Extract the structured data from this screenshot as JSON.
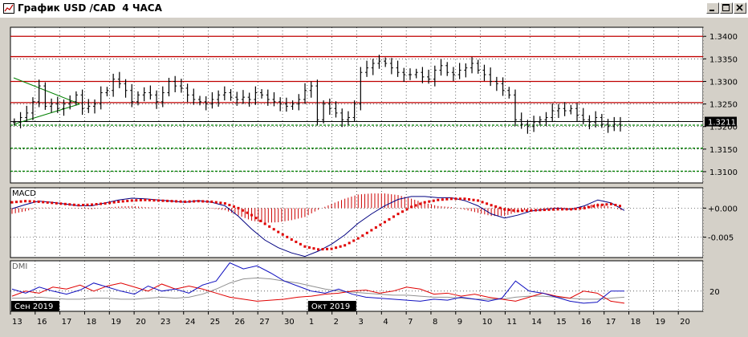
{
  "window": {
    "title": "График USD /CAD  4 ЧАСА",
    "buttons": [
      "minimize",
      "maximize",
      "close"
    ]
  },
  "colors": {
    "price_bars": "#000000",
    "resistance_lines": "#c00000",
    "support_lines": "#008000",
    "current_price_box": "#000000",
    "macd_line": "#000080",
    "macd_signal": "#e00000",
    "macd_histogram": "#cc0000",
    "dmi_plus": "#1010c0",
    "dmi_minus": "#e00000",
    "adx": "#909090"
  },
  "chart_data": {
    "type": "ohlc",
    "title": "",
    "panels": {
      "price": {
        "ylim": [
          1.3075,
          1.342
        ],
        "tick_labels": [
          "1.3400",
          "1.3350",
          "1.3300",
          "1.3250",
          "1.3200",
          "1.3150",
          "1.3100"
        ],
        "current_price": "1.3211",
        "horizontal_levels": {
          "red": [
            1.34,
            1.3355,
            1.33,
            1.3253
          ],
          "green": [
            1.3203,
            1.3152,
            1.3101
          ],
          "black": [
            1.3211
          ]
        },
        "triangle_lines": [
          {
            "color": "green",
            "from": [
              "13",
              1.3205
            ],
            "to": [
              "17",
              1.325
            ]
          },
          {
            "color": "green",
            "from": [
              "13",
              1.3308
            ],
            "to": [
              "17",
              1.325
            ]
          }
        ],
        "series": [
          {
            "day": "13",
            "close": [
              1.321,
              1.322,
              1.323,
              1.3255
            ]
          },
          {
            "day": "16",
            "close": [
              1.329,
              1.3245,
              1.325,
              1.324
            ]
          },
          {
            "day": "17",
            "close": [
              1.325,
              1.3255,
              1.327,
              1.324
            ]
          },
          {
            "day": "18",
            "close": [
              1.3245,
              1.325,
              1.3275,
              1.328
            ]
          },
          {
            "day": "19",
            "close": [
              1.3305,
              1.3295,
              1.328,
              1.3255
            ]
          },
          {
            "day": "20",
            "close": [
              1.327,
              1.3275,
              1.327,
              1.3255
            ]
          },
          {
            "day": "23",
            "close": [
              1.3275,
              1.33,
              1.329,
              1.3285
            ]
          },
          {
            "day": "24",
            "close": [
              1.327,
              1.326,
              1.3255,
              1.325
            ]
          },
          {
            "day": "25",
            "close": [
              1.326,
              1.327,
              1.3275,
              1.3265
            ]
          },
          {
            "day": "26",
            "close": [
              1.326,
              1.3265,
              1.326,
              1.3275
            ]
          },
          {
            "day": "27",
            "close": [
              1.327,
              1.326,
              1.3255,
              1.325
            ]
          },
          {
            "day": "30",
            "close": [
              1.3245,
              1.325,
              1.326,
              1.328
            ]
          },
          {
            "day": "1",
            "close": [
              1.329,
              1.3215,
              1.325,
              1.324
            ]
          },
          {
            "day": "2",
            "close": [
              1.323,
              1.3215,
              1.322,
              1.325
            ]
          },
          {
            "day": "3",
            "close": [
              1.332,
              1.333,
              1.334,
              1.3345
            ]
          },
          {
            "day": "4",
            "close": [
              1.334,
              1.333,
              1.332,
              1.3315
            ]
          },
          {
            "day": "7",
            "close": [
              1.3315,
              1.332,
              1.331,
              1.3305
            ]
          },
          {
            "day": "8",
            "close": [
              1.3325,
              1.3335,
              1.332,
              1.3315
            ]
          },
          {
            "day": "9",
            "close": [
              1.3325,
              1.333,
              1.334,
              1.3325
            ]
          },
          {
            "day": "10",
            "close": [
              1.3315,
              1.33,
              1.3295,
              1.328
            ]
          },
          {
            "day": "11",
            "close": [
              1.327,
              1.3215,
              1.3205,
              1.32
            ]
          },
          {
            "day": "14",
            "close": [
              1.321,
              1.3215,
              1.322,
              1.3235
            ]
          },
          {
            "day": "15",
            "close": [
              1.324,
              1.3235,
              1.324,
              1.3225
            ]
          },
          {
            "day": "16",
            "close": [
              1.3215,
              1.321,
              1.322,
              1.3205
            ]
          },
          {
            "day": "17",
            "close": [
              1.32,
              1.3205,
              1.3211
            ]
          }
        ]
      },
      "macd": {
        "label": "MACD",
        "tick_labels": [
          "+0.000",
          "-0.005"
        ],
        "ylim": [
          -0.0085,
          0.0035
        ],
        "macd_line": [
          -0.0001,
          0.0006,
          0.0012,
          0.001,
          0.0007,
          0.0004,
          0.0004,
          0.0009,
          0.0014,
          0.0017,
          0.0016,
          0.0014,
          0.0012,
          0.001,
          0.0013,
          0.001,
          0.0004,
          -0.0014,
          -0.0036,
          -0.0055,
          -0.0068,
          -0.0077,
          -0.0083,
          -0.0074,
          -0.0062,
          -0.0046,
          -0.0026,
          -0.001,
          0.0004,
          0.0015,
          0.002,
          0.002,
          0.0018,
          0.0018,
          0.0013,
          0.0004,
          -0.001,
          -0.0017,
          -0.0012,
          -0.0005,
          -0.0002,
          0.0,
          -0.0002,
          0.0004,
          0.0014,
          0.0009,
          -0.0004
        ],
        "signal_line": [
          0.001,
          0.0012,
          0.0011,
          0.0009,
          0.0007,
          0.0005,
          0.0006,
          0.0008,
          0.0011,
          0.0013,
          0.0014,
          0.0013,
          0.0012,
          0.0011,
          0.0012,
          0.0011,
          0.0008,
          0.0,
          -0.0012,
          -0.0027,
          -0.0041,
          -0.0054,
          -0.0066,
          -0.0071,
          -0.007,
          -0.0064,
          -0.0052,
          -0.0038,
          -0.0024,
          -0.001,
          0.0002,
          0.001,
          0.0014,
          0.0016,
          0.0016,
          0.0013,
          0.0005,
          -0.0002,
          -0.0005,
          -0.0004,
          -0.0003,
          -0.0002,
          -0.0002,
          0.0,
          0.0005,
          0.0007,
          0.0002
        ]
      },
      "dmi": {
        "label": "DMI",
        "tick_labels": [
          "20"
        ],
        "ylim": [
          0,
          50
        ],
        "plus_di": [
          22,
          18,
          24,
          20,
          17,
          21,
          28,
          24,
          20,
          17,
          25,
          20,
          22,
          18,
          26,
          30,
          48,
          42,
          45,
          38,
          30,
          25,
          20,
          18,
          22,
          17,
          14,
          13,
          12,
          11,
          10,
          12,
          11,
          14,
          12,
          10,
          13,
          30,
          20,
          18,
          14,
          10,
          8,
          9,
          20,
          20
        ],
        "minus_di": [
          15,
          20,
          18,
          24,
          22,
          26,
          20,
          25,
          28,
          24,
          20,
          27,
          22,
          25,
          22,
          18,
          14,
          12,
          10,
          11,
          12,
          14,
          15,
          17,
          18,
          20,
          21,
          18,
          20,
          24,
          22,
          17,
          18,
          15,
          17,
          14,
          12,
          10,
          14,
          18,
          15,
          13,
          20,
          18,
          10,
          8
        ],
        "adx": [
          13,
          13,
          14,
          13,
          12,
          12,
          13,
          13,
          12,
          12,
          13,
          14,
          13,
          14,
          17,
          22,
          28,
          32,
          33,
          32,
          30,
          28,
          25,
          22,
          20,
          19,
          18,
          17,
          16,
          16,
          15,
          14,
          14,
          13,
          12,
          12,
          12,
          14,
          15,
          15,
          14,
          13,
          12,
          12,
          13,
          14
        ]
      }
    },
    "x_axis": {
      "tick_labels": [
        "13",
        "16",
        "17",
        "18",
        "19",
        "20",
        "23",
        "24",
        "25",
        "26",
        "27",
        "30",
        "1",
        "2",
        "3",
        "4",
        "7",
        "8",
        "9",
        "10",
        "11",
        "14",
        "15",
        "16",
        "17",
        "18",
        "19",
        "20"
      ],
      "month_labels": [
        "Сен 2019",
        "Окт 2019"
      ]
    }
  }
}
